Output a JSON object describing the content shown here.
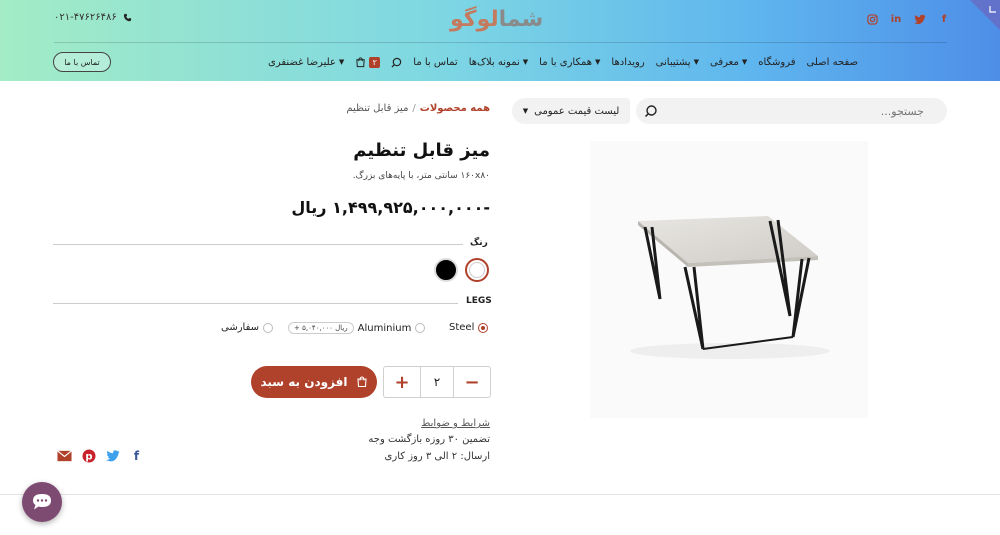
{
  "header": {
    "phone": "۰۲۱-۴۷۶۲۶۴۸۶",
    "logo_main": "لوگو",
    "logo_accent": "شما",
    "contact_button": "تماس با ما",
    "nav": [
      {
        "label": "صفحه اصلی",
        "dropdown": false
      },
      {
        "label": "فروشگاه",
        "dropdown": false
      },
      {
        "label": "معرفی",
        "dropdown": true
      },
      {
        "label": "پشتیبانی",
        "dropdown": true
      },
      {
        "label": "رویدادها",
        "dropdown": false
      },
      {
        "label": "همکاری با ما",
        "dropdown": true
      },
      {
        "label": "نمونه بلاک‌ها",
        "dropdown": true
      },
      {
        "label": "تماس با ما",
        "dropdown": false
      }
    ],
    "cart_count": "۲",
    "user_name": "علیرضا غضنفری"
  },
  "toolbar": {
    "search_placeholder": "جستجو...",
    "pricelist_label": "لیست قیمت عمومی"
  },
  "breadcrumb": {
    "parent": "همه محصولات",
    "separator": "/",
    "current": "میز قابل تنظیم"
  },
  "product": {
    "name": "میز قابل تنظیم",
    "description": "۱۶۰x۸۰ سانتی متر، با پایه‌های بزرگ.",
    "price": "-۱,۴۹۹,۹۲۵,۰۰۰,۰۰۰ ریال",
    "color_label": "رنگ",
    "colors": [
      "#ffffff",
      "#000000"
    ],
    "selected_color": "#ffffff",
    "legs_label": "LEGS",
    "legs_options": [
      {
        "label": "Steel",
        "selected": true,
        "extra": ""
      },
      {
        "label": "Aluminium",
        "selected": false,
        "extra": "+ ۵,۰۴۰,۰۰۰ ریال"
      },
      {
        "label": "سفارشی",
        "selected": false,
        "extra": ""
      }
    ],
    "quantity": "۲",
    "add_to_cart": "افزودن به سبد",
    "terms_link": "شرایط و ضوابط",
    "guarantee": "تضمین ۳۰ روزه بازگشت وجه",
    "shipping": "ارسال: ۲ الی ۳ روز کاری"
  },
  "colors": {
    "accent": "#b0412a",
    "chat": "#7d4a72"
  }
}
